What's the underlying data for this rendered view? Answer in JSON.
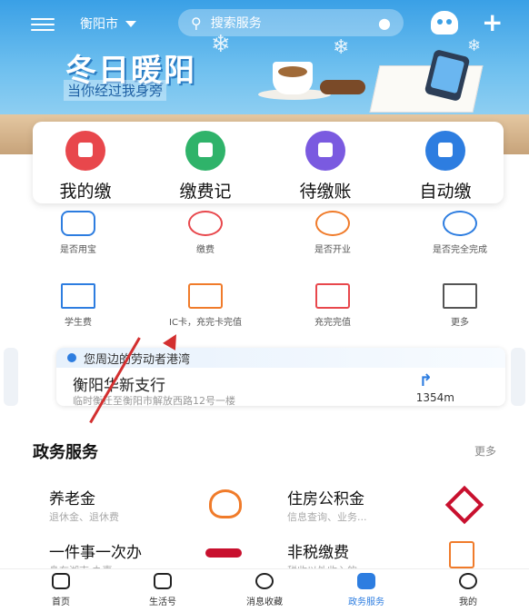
{
  "topbar": {
    "city": "衡阳市",
    "search_placeholder": "搜索服务"
  },
  "banner": {
    "title": "冬日暖阳",
    "subtitle": "当你经过我身旁"
  },
  "quick_actions": [
    {
      "label": "我的缴",
      "color": "#e8474c"
    },
    {
      "label": "缴费记",
      "color": "#2fb36a"
    },
    {
      "label": "待缴账",
      "color": "#7a5ae0"
    },
    {
      "label": "自动缴",
      "color": "#2d7de0"
    }
  ],
  "services": [
    {
      "label": "是否用宝",
      "color": "#2d7de0"
    },
    {
      "label": "缴费",
      "color": "#e8474c"
    },
    {
      "label": "是否开业",
      "color": "#f07b2a"
    },
    {
      "label": "是否完全完成",
      "color": "#2d7de0"
    },
    {
      "label": "学生费",
      "color": "#2d7de0"
    },
    {
      "label": "IC卡，充完卡完值",
      "color": "#f07b2a"
    },
    {
      "label": "充完完值",
      "color": "#e8474c"
    },
    {
      "label": "更多",
      "color": "#555555"
    }
  ],
  "outlet": {
    "header": "您周边的劳动者港湾",
    "name": "衡阳华新支行",
    "address": "临时衡迁至衡阳市解放西路12号一楼",
    "distance": "1354m"
  },
  "gov_services": {
    "title": "政务服务",
    "more": "更多",
    "items": [
      {
        "name": "养老金",
        "desc": "退休金、退休费"
      },
      {
        "name": "住房公积金",
        "desc": "信息查询、业务..."
      },
      {
        "name": "一件事一次办",
        "desc": "身在湖南 办事..."
      },
      {
        "name": "非税缴费",
        "desc": "税收以外收入的..."
      }
    ]
  },
  "tabs": [
    {
      "label": "首页"
    },
    {
      "label": "生活号"
    },
    {
      "label": "消息收藏"
    },
    {
      "label": "政务服务"
    },
    {
      "label": "我的"
    }
  ]
}
